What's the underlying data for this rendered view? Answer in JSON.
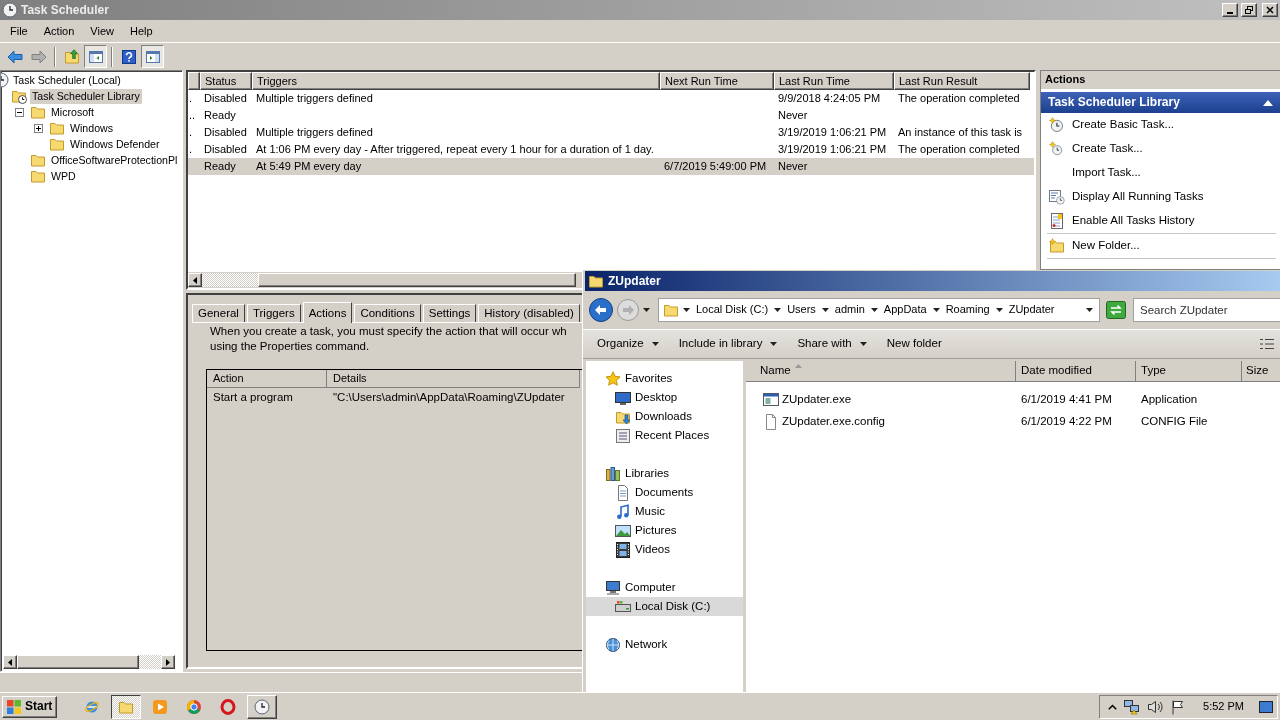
{
  "task_scheduler": {
    "title": "Task Scheduler",
    "menu": [
      "File",
      "Action",
      "View",
      "Help"
    ],
    "toolbar": [
      {
        "kind": "back",
        "disabled": false,
        "on": false
      },
      {
        "kind": "forward",
        "disabled": true,
        "on": false
      },
      {
        "kind": "up",
        "disabled": false,
        "on": false
      },
      {
        "kind": "tree-toggle",
        "disabled": false,
        "on": true
      },
      {
        "kind": "help",
        "disabled": false,
        "on": false
      },
      {
        "kind": "pane-toggle",
        "disabled": false,
        "on": true
      }
    ],
    "tree": [
      {
        "label": "Task Scheduler (Local)",
        "selected": false,
        "children": [
          {
            "label": "Task Scheduler Library",
            "selected": true,
            "children": [
              {
                "label": "Microsoft",
                "selected": false,
                "expanded": true,
                "children": [
                  {
                    "label": "Windows",
                    "selected": false,
                    "expanded": false
                  },
                  {
                    "label": "Windows Defender",
                    "selected": false
                  }
                ]
              },
              {
                "label": "OfficeSoftwareProtectionPl",
                "selected": false
              },
              {
                "label": "WPD",
                "selected": false
              }
            ]
          }
        ]
      }
    ],
    "task_table": {
      "columns": [
        "Status",
        "Triggers",
        "Next Run Time",
        "Last Run Time",
        "Last Run Result"
      ],
      "rows": [
        {
          "column_1": ".",
          "status": "Disabled",
          "triggers": "Multiple triggers defined",
          "last_run_time": "9/9/2018 4:24:05 PM",
          "last_run_result": "The operation completed",
          "selected": false
        },
        {
          "column_1": "..",
          "status": "Ready",
          "last_run_time": "Never",
          "selected": false
        },
        {
          "column_1": ".",
          "status": "Disabled",
          "triggers": "Multiple triggers defined",
          "last_run_time": "3/19/2019 1:06:21 PM",
          "last_run_result": "An instance of this task is",
          "selected": false
        },
        {
          "column_1": ".",
          "status": "Disabled",
          "triggers": "At 1:06 PM every day - After triggered, repeat every 1 hour for a duration of 1 day.",
          "last_run_time": "3/19/2019 1:06:21 PM",
          "last_run_result": "The operation completed",
          "selected": false
        },
        {
          "status": "Ready",
          "triggers": "At 5:49 PM every day",
          "next_run_time": "6/7/2019 5:49:00 PM",
          "last_run_time": "Never",
          "selected": true
        }
      ]
    },
    "detail_tabs": [
      {
        "label": "General",
        "selected": false
      },
      {
        "label": "Triggers",
        "selected": false
      },
      {
        "label": "Actions",
        "selected": true
      },
      {
        "label": "Conditions",
        "selected": false
      },
      {
        "label": "Settings",
        "selected": false
      },
      {
        "label": "History (disabled)",
        "selected": false
      }
    ],
    "actions_tab": {
      "description": [
        "When you create a task, you must specify the action that will occur wh",
        "using the Properties command."
      ],
      "columns": [
        "Action",
        "Details"
      ],
      "rows": [
        {
          "action": "Start a program",
          "details": "\"C:\\Users\\admin\\AppData\\Roaming\\ZUpdater"
        }
      ]
    },
    "actions_pane": {
      "title": "Actions",
      "section": {
        "title": "Task Scheduler Library",
        "expanded": true
      },
      "groups": [
        {
          "items": [
            "Create Basic Task...",
            "Create Task...",
            "Import Task...",
            "Display All Running Tasks",
            "Enable All Tasks History"
          ]
        },
        {
          "items": [
            "New Folder..."
          ]
        }
      ]
    }
  },
  "explorer": {
    "title": "ZUpdater",
    "back": {
      "disabled": false
    },
    "forward": {
      "disabled": true
    },
    "breadcrumb": [
      "Local Disk (C:)",
      "Users",
      "admin",
      "AppData",
      "Roaming",
      "ZUpdater"
    ],
    "search": {
      "placeholder": "Search ZUpdater"
    },
    "commands": [
      {
        "label": "Organize",
        "dropdown": true
      },
      {
        "label": "Include in library",
        "dropdown": true
      },
      {
        "label": "Share with",
        "dropdown": true
      },
      {
        "label": "New folder",
        "dropdown": false
      }
    ],
    "nav": [
      {
        "label": "Favorites",
        "selected": false,
        "children": [
          {
            "label": "Desktop",
            "selected": false
          },
          {
            "label": "Downloads",
            "selected": false
          },
          {
            "label": "Recent Places",
            "selected": false
          }
        ]
      },
      {
        "label": "Libraries",
        "selected": false,
        "children": [
          {
            "label": "Documents",
            "selected": false
          },
          {
            "label": "Music",
            "selected": false
          },
          {
            "label": "Pictures",
            "selected": false
          },
          {
            "label": "Videos",
            "selected": false
          }
        ]
      },
      {
        "label": "Computer",
        "selected": false,
        "children": [
          {
            "label": "Local Disk (C:)",
            "selected": true
          }
        ]
      },
      {
        "label": "Network",
        "selected": false
      }
    ],
    "file_columns": [
      {
        "label": "Name",
        "sorted": true
      },
      {
        "label": "Date modified",
        "sorted": false
      },
      {
        "label": "Type",
        "sorted": false
      },
      {
        "label": "Size",
        "sorted": false
      }
    ],
    "files": [
      {
        "name": "ZUpdater.exe",
        "date_modified": "6/1/2019 4:41 PM",
        "type": "Application",
        "selected": false
      },
      {
        "name": "ZUpdater.exe.config",
        "date_modified": "6/1/2019 4:22 PM",
        "type": "CONFIG File",
        "selected": false
      }
    ]
  },
  "taskbar": {
    "start": "Start",
    "items": [
      {
        "kind": "pinned",
        "selected": false
      },
      {
        "kind": "window",
        "selected": true
      },
      {
        "kind": "pinned",
        "selected": false
      },
      {
        "kind": "pinned",
        "selected": false
      },
      {
        "kind": "pinned",
        "selected": false
      },
      {
        "kind": "window",
        "selected": false
      }
    ],
    "clock": "5:52 PM"
  }
}
